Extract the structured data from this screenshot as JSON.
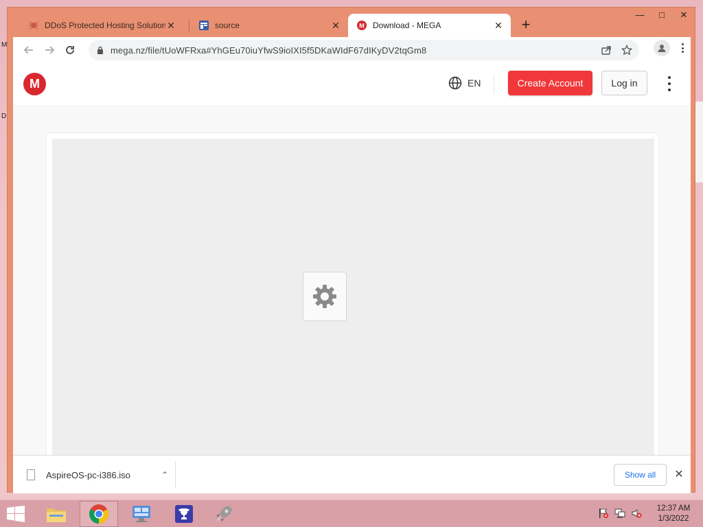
{
  "window": {
    "controls": [
      "minimize",
      "maximize",
      "close"
    ]
  },
  "tabs": [
    {
      "title": "DDoS Protected Hosting Solution",
      "icon": "spider-icon",
      "active": false
    },
    {
      "title": "source",
      "icon": "page-icon",
      "active": false
    },
    {
      "title": "Download - MEGA",
      "icon": "mega-icon",
      "active": true
    }
  ],
  "toolbar": {
    "url": "mega.nz/file/tUoWFRxa#YhGEu70iuYfwS9ioIXI5f5DKaWIdF67dIKyDV2tqGm8"
  },
  "site_header": {
    "logo_letter": "M",
    "language": "EN",
    "create_account_label": "Create Account",
    "login_label": "Log in"
  },
  "download_bar": {
    "filename": "AspireOS-pc-i386.iso",
    "show_all_label": "Show all"
  },
  "taskbar": {
    "time": "12:37 AM",
    "date": "1/3/2022"
  },
  "colors": {
    "mega_red": "#d9272e",
    "create_account_bg": "#f0373a",
    "window_frame": "#e98f72",
    "link_blue": "#1a73e8"
  }
}
